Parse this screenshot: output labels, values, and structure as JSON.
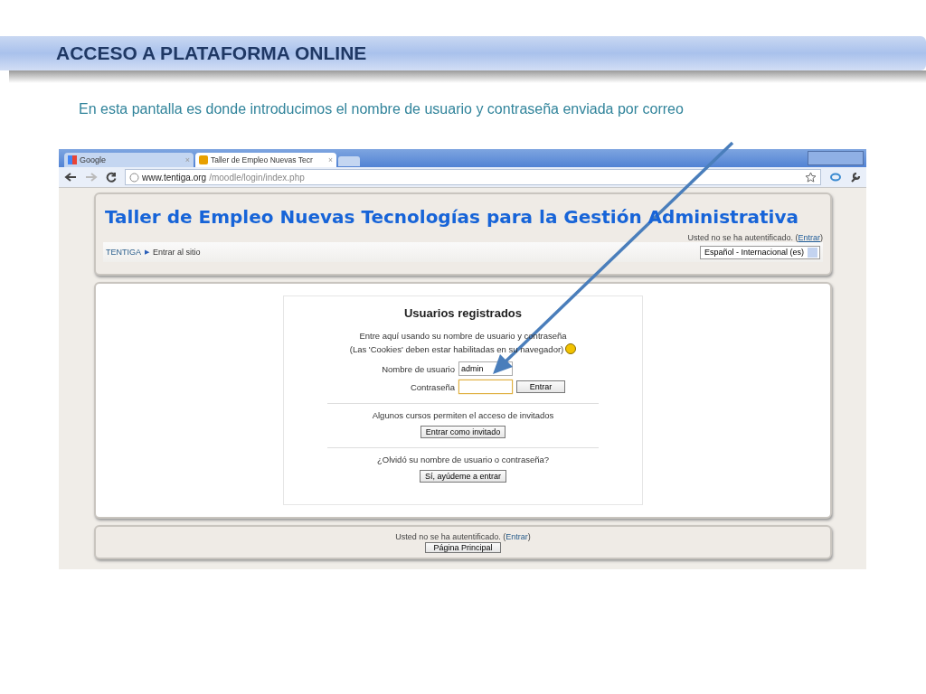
{
  "slide": {
    "title": "ACCESO A PLATAFORMA ONLINE",
    "caption": "En esta pantalla es donde introducimos el nombre de usuario y contraseña enviada por correo"
  },
  "browser": {
    "tabs": [
      {
        "label": "Google",
        "close": "×",
        "selected": false
      },
      {
        "label": "Taller de Empleo Nuevas Tecr",
        "close": "×",
        "selected": true
      }
    ],
    "address": {
      "host": "www.tentiga.org",
      "path": "/moodle/login/index.php"
    }
  },
  "site": {
    "heading": "Taller de Empleo Nuevas Tecnologías para la Gestión Administrativa",
    "login_status": {
      "prefix": "Usted no se ha autentificado. (",
      "link": "Entrar",
      "suffix": ")"
    },
    "breadcrumb": {
      "home": "TENTIGA",
      "separator": "▶",
      "current": "Entrar al sitio"
    },
    "language": "Español - Internacional (es)"
  },
  "login": {
    "title": "Usuarios registrados",
    "intro": [
      "Entre aquí usando su nombre de usuario y contraseña",
      "(Las 'Cookies' deben estar habilitadas en su navegador)"
    ],
    "fields": [
      {
        "label": "Nombre de usuario",
        "value": "admin",
        "focused": false
      },
      {
        "label": "Contraseña",
        "focused": true
      }
    ],
    "submit": "Entrar",
    "guest_text": "Algunos cursos permiten el acceso de invitados",
    "guest_button": "Entrar como invitado",
    "forgot_text": "¿Olvidó su nombre de usuario o contraseña?",
    "forgot_button": "Sí, ayúdeme a entrar"
  },
  "footer": {
    "prefix": "Usted no se ha autentificado. (",
    "link": "Entrar",
    "suffix": ")",
    "button": "Página Principal"
  }
}
